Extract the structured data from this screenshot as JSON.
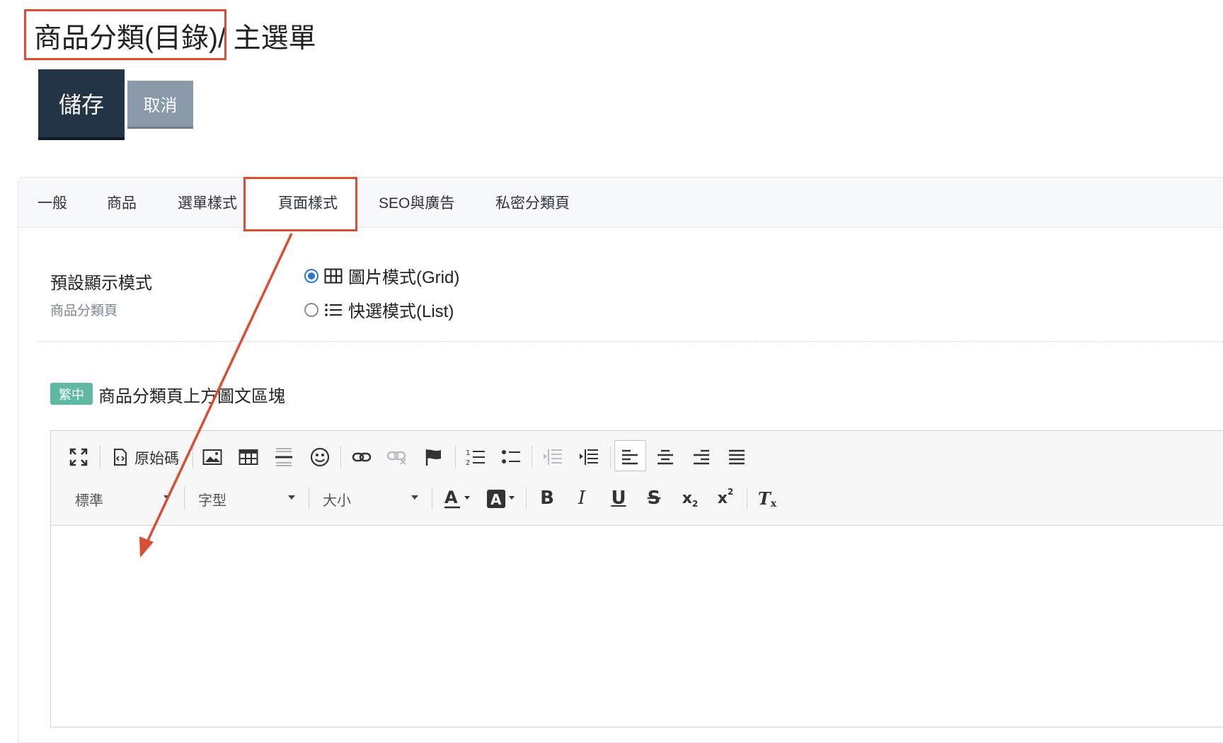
{
  "header": {
    "title_main": "商品分類(目錄)",
    "title_rest": " / 主選單"
  },
  "actions": {
    "save": "儲存",
    "cancel": "取消"
  },
  "tabs": [
    {
      "label": "一般"
    },
    {
      "label": "商品"
    },
    {
      "label": "選單樣式"
    },
    {
      "label": "頁面樣式",
      "active": true
    },
    {
      "label": "SEO與廣告"
    },
    {
      "label": "私密分類頁"
    }
  ],
  "display_mode": {
    "label": "預設顯示模式",
    "sublabel": "商品分類頁",
    "options": [
      {
        "label": "圖片模式(Grid)",
        "icon": "grid-icon",
        "selected": true
      },
      {
        "label": "快選模式(List)",
        "icon": "list-icon",
        "selected": false
      }
    ]
  },
  "content_block": {
    "lang_badge": "繁中",
    "title": "商品分類頁上方圖文區塊"
  },
  "editor": {
    "source_label": "原始碼",
    "format_select": "標準",
    "font_select": "字型",
    "size_select": "大小"
  },
  "colors": {
    "annotation_red": "#d94f36",
    "save_bg": "#243447",
    "cancel_bg": "#8a9aaa",
    "badge_green": "#5fb9a2",
    "radio_blue": "#2f76d2"
  }
}
